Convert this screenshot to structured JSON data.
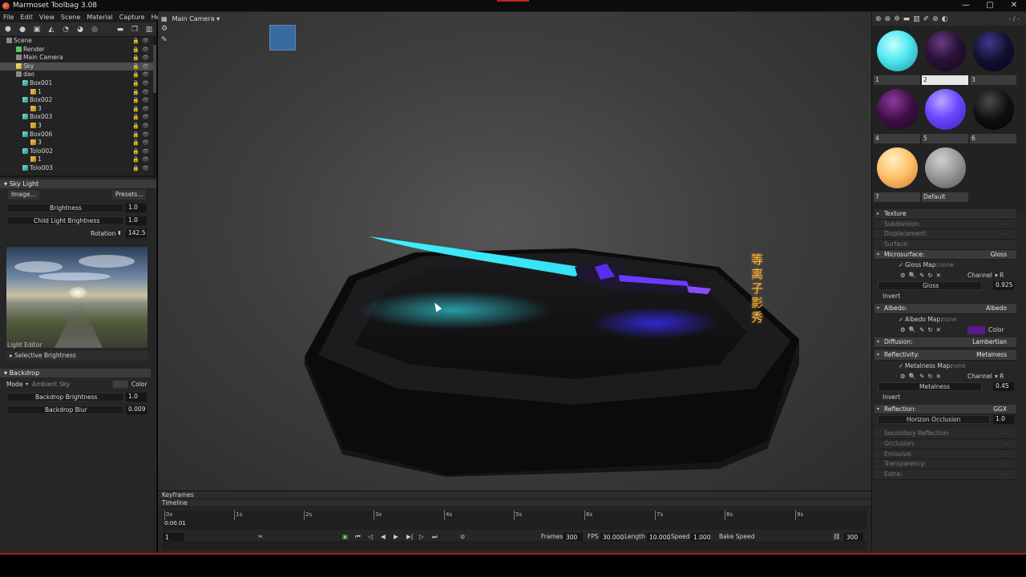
{
  "window": {
    "title": "Marmoset Toolbag 3.08",
    "controls": [
      "—",
      "▢",
      "✕"
    ]
  },
  "menu": [
    "File",
    "Edit",
    "View",
    "Scene",
    "Material",
    "Capture",
    "Help"
  ],
  "outliner": {
    "items": [
      {
        "label": "Scene",
        "icon": "scene",
        "indent": 0
      },
      {
        "label": "Render",
        "icon": "render",
        "indent": 1
      },
      {
        "label": "Main Camera",
        "icon": "camera",
        "indent": 1
      },
      {
        "label": "Sky",
        "icon": "sky",
        "indent": 1,
        "selected": true
      },
      {
        "label": "dao",
        "icon": "folder",
        "indent": 1
      },
      {
        "label": "Box001",
        "icon": "cube",
        "indent": 2
      },
      {
        "label": "1",
        "icon": "mesh",
        "indent": 3
      },
      {
        "label": "Box002",
        "icon": "cube",
        "indent": 2
      },
      {
        "label": "3",
        "icon": "mesh",
        "indent": 3
      },
      {
        "label": "Box003",
        "icon": "cube",
        "indent": 2
      },
      {
        "label": "3",
        "icon": "mesh",
        "indent": 3
      },
      {
        "label": "Box006",
        "icon": "cube",
        "indent": 2
      },
      {
        "label": "3",
        "icon": "mesh",
        "indent": 3
      },
      {
        "label": "Tolo002",
        "icon": "cube",
        "indent": 2
      },
      {
        "label": "1",
        "icon": "mesh",
        "indent": 3
      },
      {
        "label": "Tolo003",
        "icon": "cube",
        "indent": 2
      }
    ]
  },
  "sky_light": {
    "header": "Sky Light",
    "image_button": "Image...",
    "presets_button": "Presets...",
    "brightness_label": "Brightness",
    "brightness_value": "1.0",
    "child_light_label": "Child Light Brightness",
    "child_light_value": "1.0",
    "rotation_label": "Rotation",
    "rotation_value": "142.5",
    "light_editor_label": "Light Editor",
    "selective_brightness": "Selective Brightness"
  },
  "backdrop": {
    "header": "Backdrop",
    "mode_label": "Mode",
    "mode_value": "Ambient Sky",
    "color_label": "Color",
    "brightness_label": "Backdrop Brightness",
    "brightness_value": "1.0",
    "blur_label": "Backdrop Blur",
    "blur_value": "0.009"
  },
  "viewport": {
    "camera_label": "Main Camera",
    "vertical_text": "等离子影秀"
  },
  "materials": {
    "toolbar_right": "- / -",
    "swatches": [
      {
        "label": "1",
        "color": "#4fe8ef"
      },
      {
        "label": "2",
        "color": "#2a1238",
        "active": true
      },
      {
        "label": "3",
        "color": "#120f30"
      },
      {
        "label": "4",
        "color": "#3e0f45"
      },
      {
        "label": "5",
        "color": "#6b48ff"
      },
      {
        "label": "6",
        "color": "#0f0f0f"
      },
      {
        "label": "7",
        "color": "#ffc36b"
      },
      {
        "label": "Default",
        "color": "#9a9a9a"
      }
    ]
  },
  "material_props": {
    "texture": "Texture",
    "subdivision": "Subdivision:",
    "displacement": "Displacement:",
    "surface": "Surface:",
    "dash": "-",
    "microsurface": "Microsurface:",
    "microsurface_value": "Gloss",
    "gloss_map": "Gloss Map:",
    "none": "none",
    "channel": "Channel",
    "channel_value": "R",
    "gloss": "Gloss",
    "gloss_value": "0.925",
    "invert": "Invert",
    "albedo": "Albedo:",
    "albedo_value": "Albedo",
    "albedo_map": "Albedo Map:",
    "color": "Color",
    "albedo_color": "#5a1a8c",
    "diffusion": "Diffusion:",
    "diffusion_value": "Lambertian",
    "reflectivity": "Reflectivity:",
    "reflectivity_value": "Metalness",
    "metalness_map": "Metalness Map:",
    "metalness": "Metalness",
    "metalness_value": "0.45",
    "reflection": "Reflection:",
    "reflection_value": "GGX",
    "horizon_occlusion": "Horizon Occlusion",
    "horizon_value": "1.0",
    "secondary_reflection": "Secondary Reflection:",
    "occlusion": "Occlusion:",
    "emissive": "Emissive:",
    "transparency": "Transparency:",
    "extra": "Extra:"
  },
  "timeline": {
    "keyframes_label": "Keyframes",
    "timeline_label": "Timeline",
    "ticks": [
      "0s",
      "1s",
      "2s",
      "3s",
      "4s",
      "5s",
      "6s",
      "7s",
      "8s",
      "9s"
    ],
    "current_time": "0:00.01",
    "frame_field": "1",
    "frames_label": "Frames",
    "frames_value": "300",
    "fps_label": "FPS",
    "fps_value": "30.000",
    "length_label": "Length",
    "length_value": "10.000",
    "speed_label": "Speed",
    "speed_value": "1.000",
    "bake_speed": "Bake Speed",
    "end_value": "300"
  }
}
